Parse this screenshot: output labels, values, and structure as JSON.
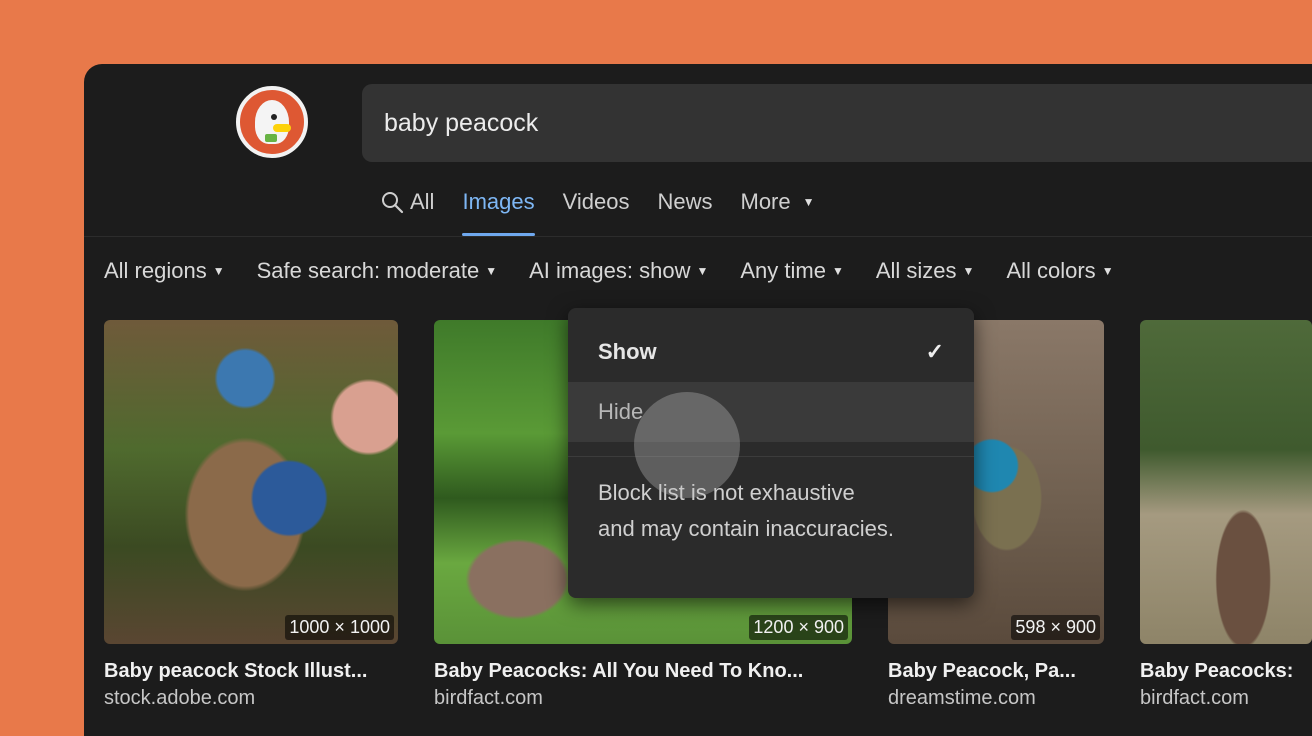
{
  "search": {
    "query": "baby peacock"
  },
  "tabs": [
    {
      "label": "All",
      "icon": "search-icon"
    },
    {
      "label": "Images",
      "active": true
    },
    {
      "label": "Videos"
    },
    {
      "label": "News"
    },
    {
      "label": "More"
    }
  ],
  "filters": [
    {
      "label": "All regions"
    },
    {
      "label": "Safe search: moderate"
    },
    {
      "label": "AI images: show"
    },
    {
      "label": "Any time"
    },
    {
      "label": "All sizes"
    },
    {
      "label": "All colors"
    }
  ],
  "dropdown": {
    "options": [
      {
        "label": "Show",
        "selected": true
      },
      {
        "label": "Hide",
        "hovered": true
      }
    ],
    "note_line1": "Block list is not exhaustive",
    "note_line2": "and may contain inaccuracies."
  },
  "results": [
    {
      "title": "Baby peacock Stock Illust...",
      "source": "stock.adobe.com",
      "dimensions": "1000 × 1000"
    },
    {
      "title": "Baby Peacocks: All You Need To Kno...",
      "source": "birdfact.com",
      "dimensions": "1200 × 900"
    },
    {
      "title": "Baby Peacock, Pa...",
      "source": "dreamstime.com",
      "dimensions": "598 × 900"
    },
    {
      "title": "Baby Peacocks:",
      "source": "birdfact.com",
      "dimensions": ""
    }
  ],
  "colors": {
    "accent": "#7eb7f5",
    "background": "#1c1c1c",
    "backdrop": "#e8794a"
  }
}
